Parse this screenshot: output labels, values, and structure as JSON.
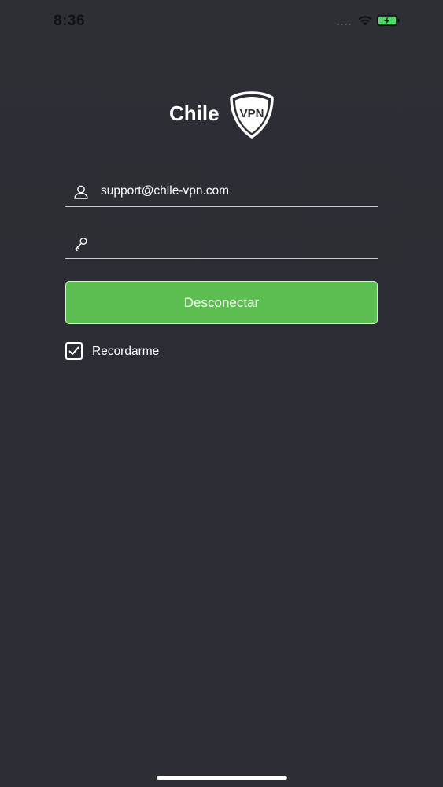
{
  "status_bar": {
    "time": "8:36",
    "battery_color": "#4cd964",
    "icons": [
      "signal-icon",
      "wifi-icon",
      "battery-charging-icon"
    ]
  },
  "logo": {
    "text": "Chile",
    "shield_text": "VPN"
  },
  "form": {
    "email_value": "support@chile-vpn.com",
    "password_value": "",
    "button_label": "Desconectar",
    "remember_label": "Recordarme",
    "remember_checked": true
  },
  "colors": {
    "background": "#2c2d35",
    "accent": "#5cbd51"
  }
}
